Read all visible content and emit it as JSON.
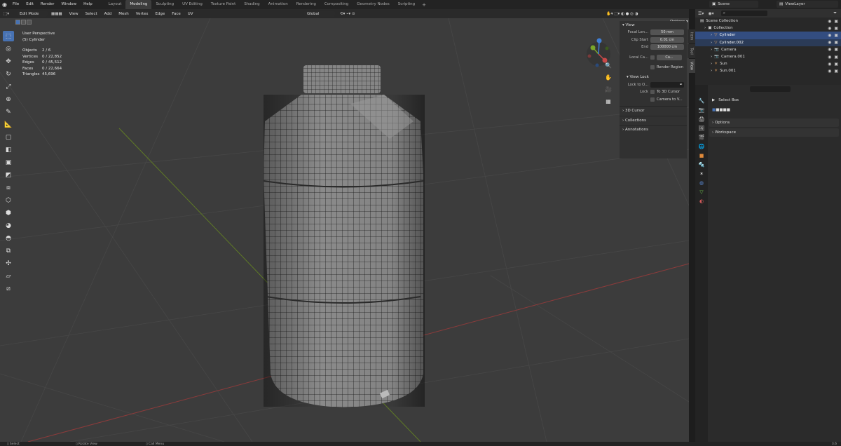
{
  "menubar": {
    "items": [
      "File",
      "Edit",
      "Render",
      "Window",
      "Help"
    ],
    "workspaces": [
      "Layout",
      "Modeling",
      "Sculpting",
      "UV Editing",
      "Texture Paint",
      "Shading",
      "Animation",
      "Rendering",
      "Compositing",
      "Geometry Nodes",
      "Scripting"
    ],
    "active_workspace": "Modeling",
    "scene": "Scene",
    "view_layer": "ViewLayer"
  },
  "viewport_header": {
    "mode": "Edit Mode",
    "menus": [
      "View",
      "Select",
      "Add",
      "Mesh",
      "Vertex",
      "Edge",
      "Face",
      "UV"
    ],
    "orientation": "Global"
  },
  "overlay": {
    "view_name": "User Perspective",
    "object": "(5) Cylinder",
    "stats": [
      {
        "label": "Objects",
        "value": "2 / 6"
      },
      {
        "label": "Vertices",
        "value": "0 / 22,852"
      },
      {
        "label": "Edges",
        "value": "0 / 45,512"
      },
      {
        "label": "Faces",
        "value": "0 / 22,664"
      },
      {
        "label": "Triangles",
        "value": "45,696"
      }
    ]
  },
  "npanel": {
    "options": "Options",
    "view_header": "View",
    "focal_label": "Focal Len...",
    "focal_value": "50 mm",
    "clip_start_label": "Clip Start",
    "clip_start_value": "0.01 cm",
    "clip_end_label": "End",
    "clip_end_value": "100000 cm",
    "local_cam_label": "Local Ca...",
    "local_cam_value": "Ca...",
    "render_region": "Render Region",
    "view_lock": "View Lock",
    "lock_to_label": "Lock to O...",
    "lock_label": "Lock",
    "to_3d_cursor": "To 3D Cursor",
    "camera_to_view": "Camera to V...",
    "sections": [
      "3D Cursor",
      "Collections",
      "Annotations"
    ],
    "tabs": [
      "Item",
      "Tool",
      "View"
    ]
  },
  "outliner": {
    "rows": [
      {
        "name": "Scene Collection",
        "indent": 0,
        "icon": "scene-collection-icon"
      },
      {
        "name": "Collection",
        "indent": 1,
        "icon": "collection-icon"
      },
      {
        "name": "Cylinder",
        "indent": 2,
        "icon": "mesh-icon",
        "selected": "active"
      },
      {
        "name": "Cylinder.002",
        "indent": 2,
        "icon": "mesh-icon",
        "selected": "secondary"
      },
      {
        "name": "Camera",
        "indent": 2,
        "icon": "camera-icon"
      },
      {
        "name": "Camera.001",
        "indent": 2,
        "icon": "camera-icon"
      },
      {
        "name": "Sun",
        "indent": 2,
        "icon": "light-icon"
      },
      {
        "name": "Sun.001",
        "indent": 2,
        "icon": "light-icon"
      }
    ]
  },
  "properties": {
    "tool_name": "Select Box",
    "panels": [
      "Options",
      "Workspace"
    ]
  },
  "statusbar": {
    "left": "Select",
    "middle": "Rotate View",
    "right": "Call Menu",
    "version": "3.6"
  },
  "colors": {
    "accent": "#4772b3",
    "axis_x": "#c84848",
    "axis_y": "#7aa62a"
  }
}
